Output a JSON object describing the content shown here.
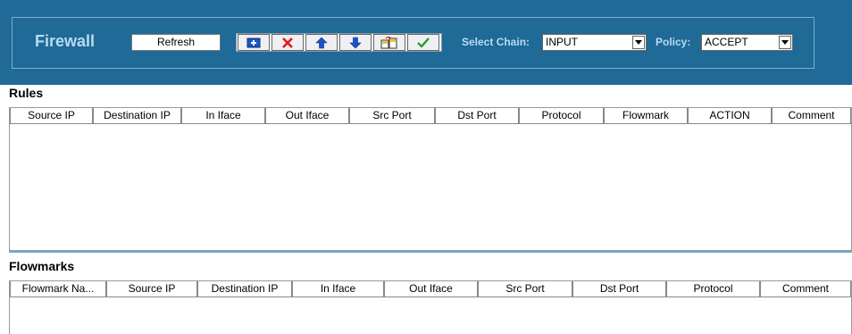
{
  "app": {
    "title": "Firewall",
    "refresh_label": "Refresh"
  },
  "toolbar": {
    "icons": [
      "add-icon",
      "delete-icon",
      "move-up-icon",
      "move-down-icon",
      "copy-icon",
      "apply-icon"
    ]
  },
  "chain": {
    "label": "Select Chain:",
    "value": "INPUT"
  },
  "policy": {
    "label": "Policy:",
    "value": "ACCEPT"
  },
  "rules": {
    "title": "Rules",
    "columns": [
      "Source IP",
      "Destination IP",
      "In Iface",
      "Out Iface",
      "Src Port",
      "Dst Port",
      "Protocol",
      "Flowmark",
      "ACTION",
      "Comment"
    ]
  },
  "flowmarks": {
    "title": "Flowmarks",
    "columns": [
      "Flowmark Na...",
      "Source IP",
      "Destination IP",
      "In Iface",
      "Out Iface",
      "Src Port",
      "Dst Port",
      "Protocol",
      "Comment"
    ]
  },
  "colors": {
    "header_bg": "#1f6a96",
    "header_text": "#b9dbf1"
  }
}
